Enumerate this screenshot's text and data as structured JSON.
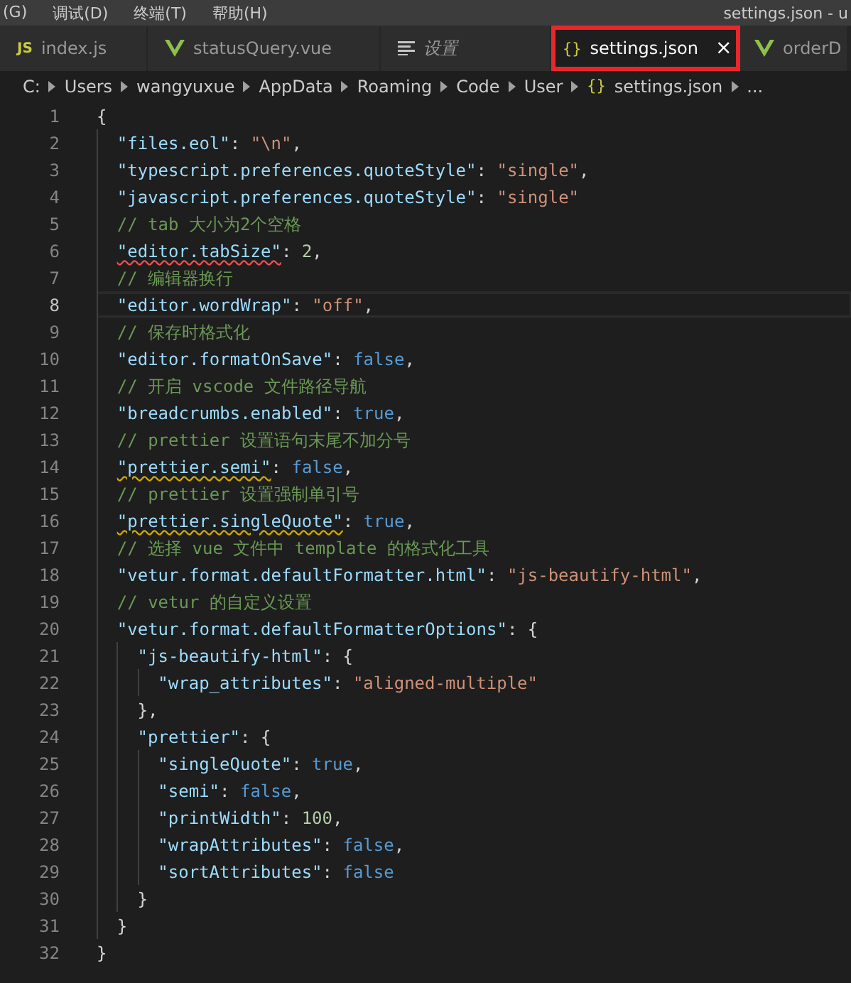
{
  "menu_bar": {
    "items": [
      "(G)",
      "调试(D)",
      "终端(T)",
      "帮助(H)"
    ],
    "title": "settings.json - u"
  },
  "tabs": [
    {
      "label": "index.js",
      "kind": "js",
      "icon_text": "JS",
      "selected": false,
      "italic": false
    },
    {
      "label": "statusQuery.vue",
      "kind": "vue",
      "selected": false,
      "italic": false
    },
    {
      "label": "设置",
      "kind": "lines",
      "selected": false,
      "italic": true
    },
    {
      "label": "settings.json",
      "kind": "json",
      "icon_text": "{}",
      "selected": true,
      "italic": false,
      "close": "×"
    },
    {
      "label": "orderD",
      "kind": "vue",
      "selected": false,
      "italic": false
    }
  ],
  "breadcrumbs": [
    {
      "label": "C:"
    },
    {
      "label": "Users"
    },
    {
      "label": "wangyuxue"
    },
    {
      "label": "AppData"
    },
    {
      "label": "Roaming"
    },
    {
      "label": "Code"
    },
    {
      "label": "User"
    },
    {
      "label": "settings.json",
      "icon_text": "{}"
    },
    {
      "label": "..."
    }
  ],
  "editor": {
    "lines": [
      {
        "number": "1",
        "current": false,
        "error": false,
        "warning": false,
        "tokens": [
          {
            "kind": "punct",
            "text": "{"
          }
        ],
        "children": [
          {
            "number": "2",
            "current": false,
            "error": false,
            "warning": false,
            "tokens": [
              {
                "kind": "key",
                "text": "\"files.eol\""
              },
              {
                "kind": "punct",
                "text": ": "
              },
              {
                "kind": "string",
                "text": "\"\\n\""
              },
              {
                "kind": "punct",
                "text": ","
              }
            ]
          },
          {
            "number": "3",
            "current": false,
            "error": false,
            "warning": false,
            "tokens": [
              {
                "kind": "key",
                "text": "\"typescript.preferences.quoteStyle\""
              },
              {
                "kind": "punct",
                "text": ": "
              },
              {
                "kind": "string",
                "text": "\"single\""
              },
              {
                "kind": "punct",
                "text": ","
              }
            ]
          },
          {
            "number": "4",
            "current": false,
            "error": false,
            "warning": false,
            "tokens": [
              {
                "kind": "key",
                "text": "\"javascript.preferences.quoteStyle\""
              },
              {
                "kind": "punct",
                "text": ": "
              },
              {
                "kind": "string",
                "text": "\"single\""
              }
            ]
          },
          {
            "number": "5",
            "current": false,
            "error": false,
            "warning": false,
            "tokens": [
              {
                "kind": "comment",
                "text": "// tab 大小为2个空格"
              }
            ]
          },
          {
            "number": "6",
            "current": false,
            "error": true,
            "warning": false,
            "tokens": [
              {
                "kind": "key",
                "text": "\"editor.tabSize\""
              },
              {
                "kind": "punct",
                "text": ": "
              },
              {
                "kind": "number",
                "text": "2"
              },
              {
                "kind": "punct",
                "text": ","
              }
            ]
          },
          {
            "number": "7",
            "current": false,
            "error": false,
            "warning": false,
            "tokens": [
              {
                "kind": "comment",
                "text": "// 编辑器换行"
              }
            ]
          },
          {
            "number": "8",
            "current": true,
            "error": false,
            "warning": false,
            "tokens": [
              {
                "kind": "key",
                "text": "\"editor.wordWrap\""
              },
              {
                "kind": "punct",
                "text": ": "
              },
              {
                "kind": "string",
                "text": "\"off\""
              },
              {
                "kind": "punct",
                "text": ","
              }
            ]
          },
          {
            "number": "9",
            "current": false,
            "error": false,
            "warning": false,
            "tokens": [
              {
                "kind": "comment",
                "text": "// 保存时格式化"
              }
            ]
          },
          {
            "number": "10",
            "current": false,
            "error": false,
            "warning": false,
            "tokens": [
              {
                "kind": "key",
                "text": "\"editor.formatOnSave\""
              },
              {
                "kind": "punct",
                "text": ": "
              },
              {
                "kind": "bool",
                "text": "false"
              },
              {
                "kind": "punct",
                "text": ","
              }
            ]
          },
          {
            "number": "11",
            "current": false,
            "error": false,
            "warning": false,
            "tokens": [
              {
                "kind": "comment",
                "text": "// 开启 vscode 文件路径导航"
              }
            ]
          },
          {
            "number": "12",
            "current": false,
            "error": false,
            "warning": false,
            "tokens": [
              {
                "kind": "key",
                "text": "\"breadcrumbs.enabled\""
              },
              {
                "kind": "punct",
                "text": ": "
              },
              {
                "kind": "bool",
                "text": "true"
              },
              {
                "kind": "punct",
                "text": ","
              }
            ]
          },
          {
            "number": "13",
            "current": false,
            "error": false,
            "warning": false,
            "tokens": [
              {
                "kind": "comment",
                "text": "// prettier 设置语句末尾不加分号"
              }
            ]
          },
          {
            "number": "14",
            "current": false,
            "error": false,
            "warning": true,
            "tokens": [
              {
                "kind": "key",
                "text": "\"prettier.semi\""
              },
              {
                "kind": "punct",
                "text": ": "
              },
              {
                "kind": "bool",
                "text": "false"
              },
              {
                "kind": "punct",
                "text": ","
              }
            ]
          },
          {
            "number": "15",
            "current": false,
            "error": false,
            "warning": false,
            "tokens": [
              {
                "kind": "comment",
                "text": "// prettier 设置强制单引号"
              }
            ]
          },
          {
            "number": "16",
            "current": false,
            "error": false,
            "warning": true,
            "tokens": [
              {
                "kind": "key",
                "text": "\"prettier.singleQuote\""
              },
              {
                "kind": "punct",
                "text": ": "
              },
              {
                "kind": "bool",
                "text": "true"
              },
              {
                "kind": "punct",
                "text": ","
              }
            ]
          },
          {
            "number": "17",
            "current": false,
            "error": false,
            "warning": false,
            "tokens": [
              {
                "kind": "comment",
                "text": "// 选择 vue 文件中 template 的格式化工具"
              }
            ]
          },
          {
            "number": "18",
            "current": false,
            "error": false,
            "warning": false,
            "tokens": [
              {
                "kind": "key",
                "text": "\"vetur.format.defaultFormatter.html\""
              },
              {
                "kind": "punct",
                "text": ": "
              },
              {
                "kind": "string",
                "text": "\"js-beautify-html\""
              },
              {
                "kind": "punct",
                "text": ","
              }
            ]
          },
          {
            "number": "19",
            "current": false,
            "error": false,
            "warning": false,
            "tokens": [
              {
                "kind": "comment",
                "text": "// vetur 的自定义设置"
              }
            ]
          },
          {
            "number": "20",
            "current": false,
            "error": false,
            "warning": false,
            "tokens": [
              {
                "kind": "key",
                "text": "\"vetur.format.defaultFormatterOptions\""
              },
              {
                "kind": "punct",
                "text": ": {"
              }
            ],
            "children": [
              {
                "number": "21",
                "current": false,
                "error": false,
                "warning": false,
                "tokens": [
                  {
                    "kind": "key",
                    "text": "\"js-beautify-html\""
                  },
                  {
                    "kind": "punct",
                    "text": ": {"
                  }
                ],
                "children": [
                  {
                    "number": "22",
                    "current": false,
                    "error": false,
                    "warning": false,
                    "tokens": [
                      {
                        "kind": "key",
                        "text": "\"wrap_attributes\""
                      },
                      {
                        "kind": "punct",
                        "text": ": "
                      },
                      {
                        "kind": "string",
                        "text": "\"aligned-multiple\""
                      }
                    ]
                  }
                ]
              },
              {
                "number": "23",
                "current": false,
                "error": false,
                "warning": false,
                "tokens": [
                  {
                    "kind": "punct",
                    "text": "},"
                  }
                ]
              },
              {
                "number": "24",
                "current": false,
                "error": false,
                "warning": false,
                "tokens": [
                  {
                    "kind": "key",
                    "text": "\"prettier\""
                  },
                  {
                    "kind": "punct",
                    "text": ": {"
                  }
                ],
                "children": [
                  {
                    "number": "25",
                    "current": false,
                    "error": false,
                    "warning": false,
                    "tokens": [
                      {
                        "kind": "key",
                        "text": "\"singleQuote\""
                      },
                      {
                        "kind": "punct",
                        "text": ": "
                      },
                      {
                        "kind": "bool",
                        "text": "true"
                      },
                      {
                        "kind": "punct",
                        "text": ","
                      }
                    ]
                  },
                  {
                    "number": "26",
                    "current": false,
                    "error": false,
                    "warning": false,
                    "tokens": [
                      {
                        "kind": "key",
                        "text": "\"semi\""
                      },
                      {
                        "kind": "punct",
                        "text": ": "
                      },
                      {
                        "kind": "bool",
                        "text": "false"
                      },
                      {
                        "kind": "punct",
                        "text": ","
                      }
                    ]
                  },
                  {
                    "number": "27",
                    "current": false,
                    "error": false,
                    "warning": false,
                    "tokens": [
                      {
                        "kind": "key",
                        "text": "\"printWidth\""
                      },
                      {
                        "kind": "punct",
                        "text": ": "
                      },
                      {
                        "kind": "number",
                        "text": "100"
                      },
                      {
                        "kind": "punct",
                        "text": ","
                      }
                    ]
                  },
                  {
                    "number": "28",
                    "current": false,
                    "error": false,
                    "warning": false,
                    "tokens": [
                      {
                        "kind": "key",
                        "text": "\"wrapAttributes\""
                      },
                      {
                        "kind": "punct",
                        "text": ": "
                      },
                      {
                        "kind": "bool",
                        "text": "false"
                      },
                      {
                        "kind": "punct",
                        "text": ","
                      }
                    ]
                  },
                  {
                    "number": "29",
                    "current": false,
                    "error": false,
                    "warning": false,
                    "tokens": [
                      {
                        "kind": "key",
                        "text": "\"sortAttributes\""
                      },
                      {
                        "kind": "punct",
                        "text": ": "
                      },
                      {
                        "kind": "bool",
                        "text": "false"
                      }
                    ]
                  }
                ]
              },
              {
                "number": "30",
                "current": false,
                "error": false,
                "warning": false,
                "tokens": [
                  {
                    "kind": "punct",
                    "text": "}"
                  }
                ]
              }
            ]
          },
          {
            "number": "31",
            "current": false,
            "error": false,
            "warning": false,
            "tokens": [
              {
                "kind": "punct",
                "text": "}"
              }
            ]
          }
        ]
      },
      {
        "number": "32",
        "current": false,
        "error": false,
        "warning": false,
        "tokens": [
          {
            "kind": "punct",
            "text": "}"
          }
        ]
      }
    ]
  }
}
